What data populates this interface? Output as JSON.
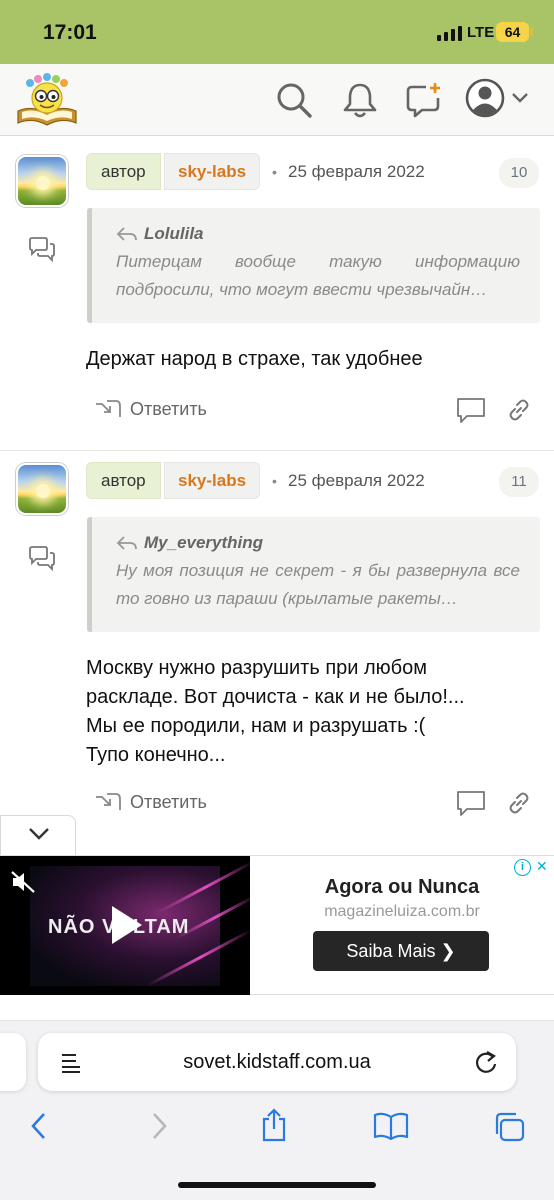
{
  "status_bar": {
    "time": "17:01",
    "network": "LTE",
    "battery": "64"
  },
  "header": {
    "logo": "book-smiley-logo",
    "icons": [
      "search-icon",
      "bell-icon",
      "new-message-icon",
      "user-avatar-icon",
      "chevron-down-icon"
    ]
  },
  "comments": [
    {
      "author_tag": "автор",
      "username": "sky-labs",
      "date": "25 февраля 2022",
      "number": "10",
      "quote_author": "Lolulila",
      "quote_text": "Питерцам вообще такую информацию подбросили, что могут ввести чрезвычайн…",
      "text": "Держат народ в страхе, так удобнее",
      "reply_label": "Ответить"
    },
    {
      "author_tag": "автор",
      "username": "sky-labs",
      "date": "25 февраля 2022",
      "number": "11",
      "quote_author": "My_everything",
      "quote_text": "Ну моя позиция не секрет - я бы развернула все то говно из параши (крылатые ракеты…",
      "text": "Москву нужно разрушить при любом\nраскладе. Вот дочиста - как и не было!...\nМы ее породили, нам и разрушать :(\nТупо конечно...",
      "reply_label": "Ответить"
    }
  ],
  "ad": {
    "video_headline": "NÃO VOLTAM",
    "title": "Agora ou Nunca",
    "url": "magazineluiza.com.br",
    "button": "Saiba Mais"
  },
  "browser": {
    "url": "sovet.kidstaff.com.ua"
  },
  "colors": {
    "status_bar": "#a9c466",
    "username": "#d9771c",
    "author_tag_bg": "#e9f1d5"
  }
}
